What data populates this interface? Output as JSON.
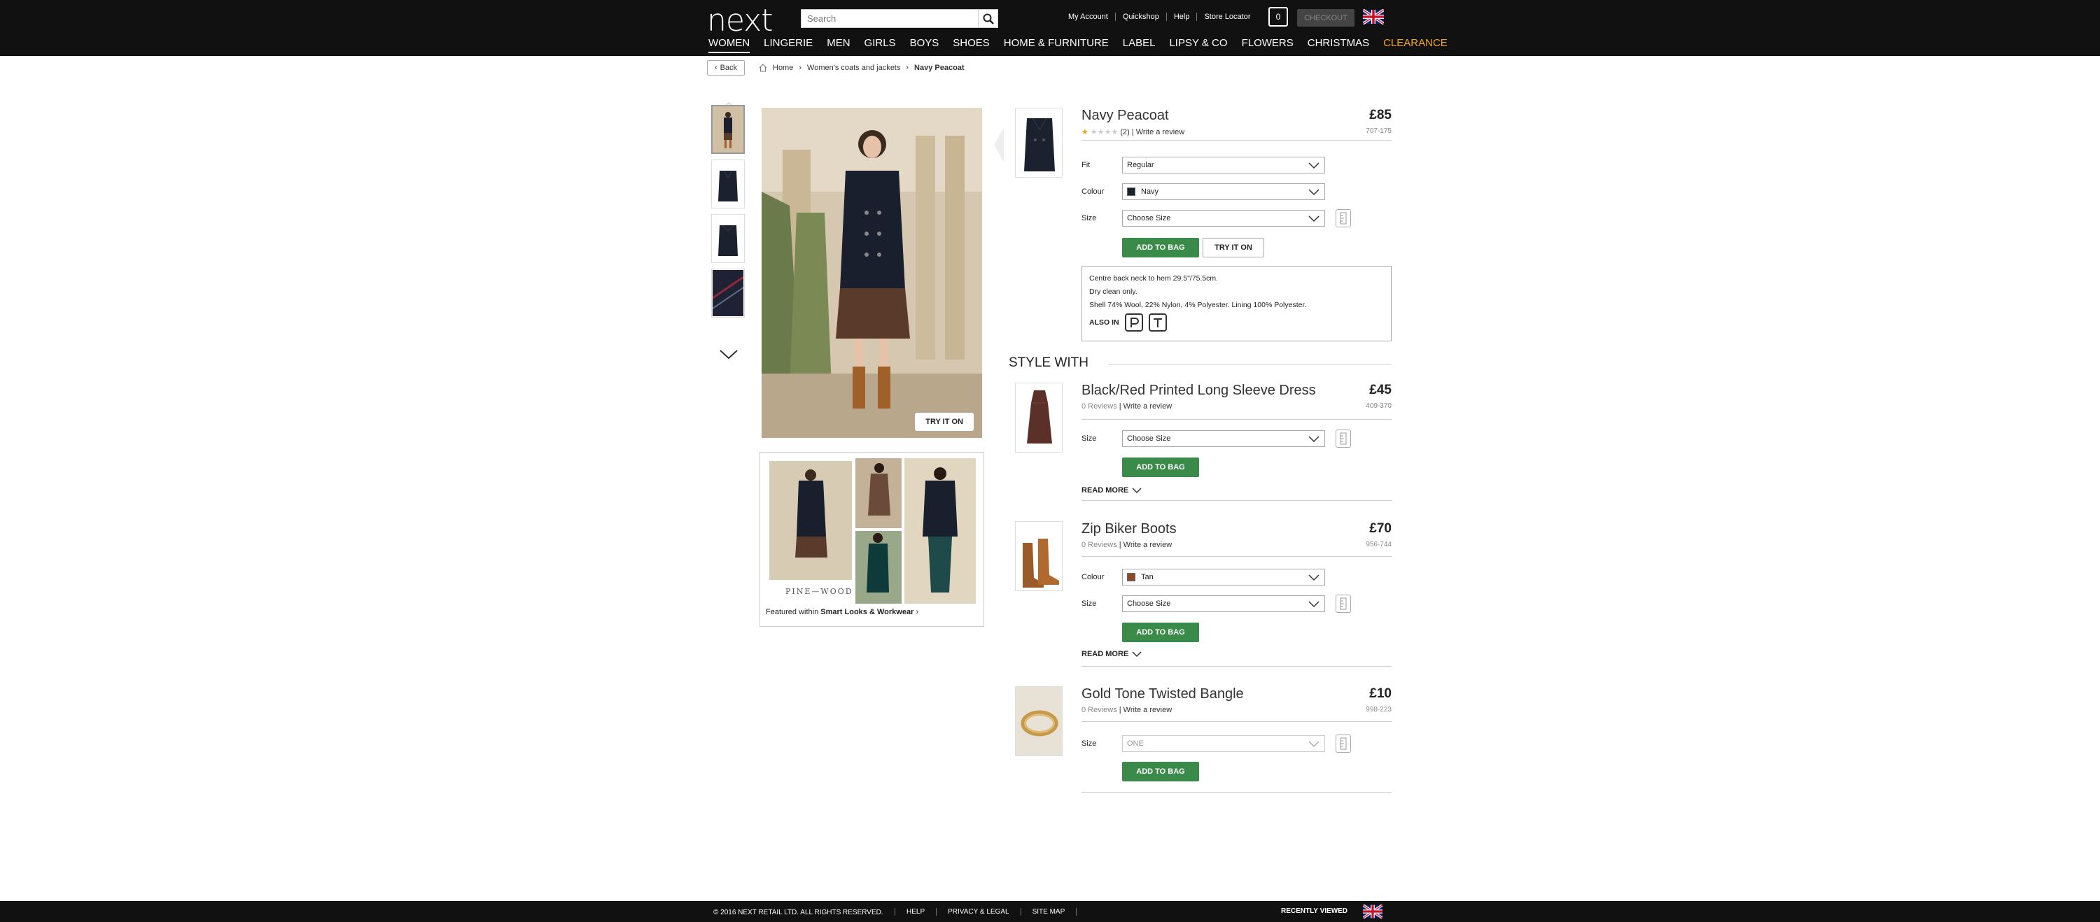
{
  "header": {
    "logo": "next",
    "search_placeholder": "Search",
    "links": [
      "My Account",
      "Quickshop",
      "Help",
      "Store Locator"
    ],
    "bag_count": "0",
    "checkout_label": "CHECKOUT"
  },
  "nav": [
    "WOMEN",
    "LINGERIE",
    "MEN",
    "GIRLS",
    "BOYS",
    "SHOES",
    "HOME & FURNITURE",
    "LABEL",
    "LIPSY & CO",
    "FLOWERS",
    "CHRISTMAS",
    "CLEARANCE"
  ],
  "breadcrumb": {
    "back_label": "Back",
    "items": [
      "Home",
      "Women's coats and jackets",
      "Navy Peacoat"
    ]
  },
  "gallery": {
    "try_it_on_label": "TRY IT ON",
    "promo_brand": "PINE—WOOD",
    "promo_prefix": "Featured within",
    "promo_link": "Smart Looks & Workwear"
  },
  "main_product": {
    "title": "Navy Peacoat",
    "price": "£85",
    "code": "707-175",
    "rating": 1,
    "rating_max": 5,
    "review_text": "(2) | Write a review",
    "fit_label": "Fit",
    "fit_value": "Regular",
    "colour_label": "Colour",
    "colour_value": "Navy",
    "size_label": "Size",
    "size_value": "Choose Size",
    "add_label": "ADD TO BAG",
    "try_label": "TRY IT ON",
    "desc_lines": [
      "Centre back neck to hem 29.5\"/75.5cm.",
      "Dry clean only.",
      "Shell 74% Wool, 22% Nylon, 4% Polyester. Lining 100% Polyester."
    ],
    "also_in_label": "ALSO IN"
  },
  "style_with": {
    "heading": "STYLE WITH",
    "items": [
      {
        "title": "Black/Red Printed Long Sleeve Dress",
        "price": "£45",
        "code": "409-370",
        "reviews": "0 Reviews",
        "write": "| Write a review",
        "size_label": "Size",
        "size_value": "Choose Size",
        "add_label": "ADD TO BAG",
        "read_more": "READ MORE"
      },
      {
        "title": "Zip Biker Boots",
        "price": "£70",
        "code": "956-744",
        "reviews": "0 Reviews",
        "write": "| Write a review",
        "colour_label": "Colour",
        "colour_value": "Tan",
        "size_label": "Size",
        "size_value": "Choose Size",
        "add_label": "ADD TO BAG",
        "read_more": "READ MORE"
      },
      {
        "title": "Gold Tone Twisted Bangle",
        "price": "£10",
        "code": "998-223",
        "reviews": "0 Reviews",
        "write": "| Write a review",
        "size_label": "Size",
        "size_value": "ONE",
        "add_label": "ADD TO BAG"
      }
    ]
  },
  "footer": {
    "copyright": "© 2016 NEXT RETAIL LTD. ALL RIGHTS RESERVED.",
    "links": [
      "HELP",
      "PRIVACY & LEGAL",
      "SITE MAP"
    ],
    "recently_viewed": "RECENTLY VIEWED"
  },
  "colors": {
    "topbar": "#111111",
    "add_button": "#3a8a4a",
    "clearance": "#f5a623",
    "navy_swatch": "#1a1f2e",
    "tan_swatch": "#8a4a2a"
  }
}
